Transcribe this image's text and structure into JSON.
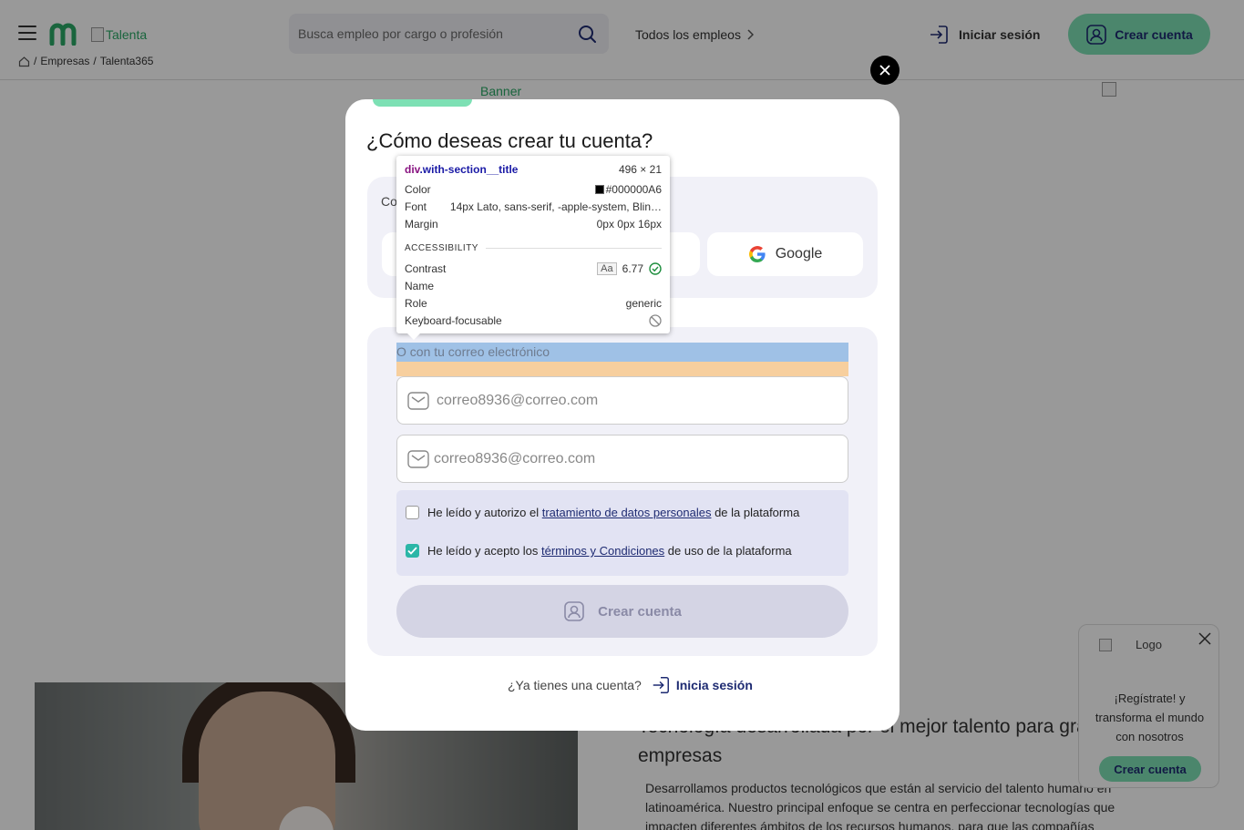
{
  "header": {
    "brand_alt": "Talenta",
    "search_placeholder": "Busca empleo por cargo o profesión",
    "all_jobs": "Todos los empleos",
    "login": "Iniciar sesión",
    "create_account": "Crear cuenta",
    "breadcrumb": [
      "Empresas",
      "Talenta365"
    ]
  },
  "background": {
    "banner_alt": "Banner",
    "about_title": "Tecnología desarrollada por el mejor talento para grandes empresas",
    "about_body": "Desarrollamos productos tecnológicos que están al servicio del talento humano en latinoamérica. Nuestro principal enfoque se centra en perfeccionar tecnologías que impacten diferentes ámbitos de los recursos humanos, para que las compañías"
  },
  "popup": {
    "logo_alt": "Logo",
    "text": "¡Regístrate! y transforma el mundo con nosotros",
    "button": "Crear cuenta"
  },
  "modal": {
    "title": "¿Cómo deseas crear tu cuenta?",
    "social_label": "Co",
    "google": "Google",
    "section_title": "O con tu correo electrónico",
    "email_placeholder": "correo8936@correo.com",
    "email_confirm_placeholder": "correo8936@correo.com",
    "consent_data": {
      "before": "He leído y autorizo el ",
      "link": "tratamiento de datos personales",
      "after": " de la plataforma",
      "checked": false
    },
    "consent_terms": {
      "before": "He leído y acepto los ",
      "link": "términos y Condiciones",
      "after": " de uso de la plataforma",
      "checked": true
    },
    "submit": "Crear cuenta",
    "have_account": "¿Ya tienes una cuenta?",
    "login_link": "Inicia sesión"
  },
  "inspector": {
    "selector_tag": "div",
    "selector_class": ".with-section__title",
    "size": "496 × 21",
    "color_label": "Color",
    "color_value": "#000000A6",
    "font_label": "Font",
    "font_value": "14px Lato, sans-serif, -apple-system, Blin…",
    "margin_label": "Margin",
    "margin_value": "0px 0px 16px",
    "accessibility_heading": "ACCESSIBILITY",
    "contrast_label": "Contrast",
    "contrast_aa": "Aa",
    "contrast_value": "6.77",
    "name_label": "Name",
    "name_value": "",
    "role_label": "Role",
    "role_value": "generic",
    "keyboard_label": "Keyboard-focusable"
  },
  "colors": {
    "accent_green": "#7de0b4",
    "brand_navy": "#1e2b72",
    "check_teal": "#2bb6a7"
  }
}
